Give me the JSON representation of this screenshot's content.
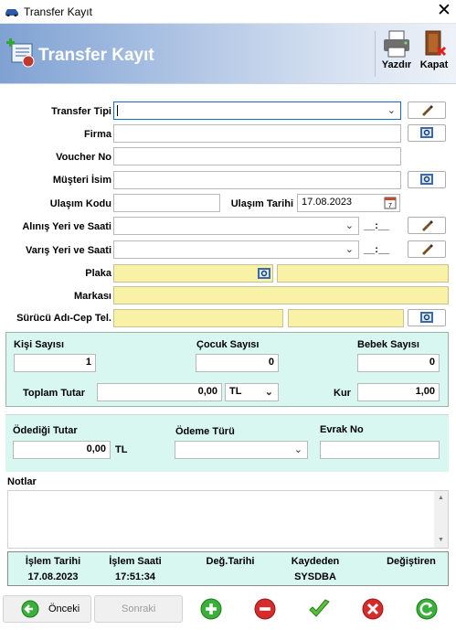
{
  "window": {
    "title": "Transfer Kayıt",
    "close_glyph": "✕"
  },
  "header": {
    "title": "Transfer Kayıt",
    "print_label": "Yazdır",
    "close_label": "Kapat"
  },
  "form": {
    "transfer_tipi_label": "Transfer Tipi",
    "firma_label": "Firma",
    "voucher_label": "Voucher No",
    "musteri_label": "Müşteri İsim",
    "ulasim_kodu_label": "Ulaşım Kodu",
    "ulasim_tarihi_label": "Ulaşım Tarihi",
    "ulasim_tarihi_value": "17.08.2023",
    "alinis_label": "Alınış Yeri ve Saati",
    "alinis_time": "__:__",
    "varis_label": "Varış Yeri ve Saati",
    "varis_time": "__:__",
    "plaka_label": "Plaka",
    "markasi_label": "Markası",
    "surucu_label": "Sürücü Adı-Cep Tel."
  },
  "counts": {
    "kisi_label": "Kişi Sayısı",
    "kisi_value": "1",
    "cocuk_label": "Çocuk Sayısı",
    "cocuk_value": "0",
    "bebek_label": "Bebek Sayısı",
    "bebek_value": "0",
    "toplam_label": "Toplam Tutar",
    "toplam_value": "0,00",
    "currency_value": "TL",
    "kur_label": "Kur",
    "kur_value": "1,00"
  },
  "payment": {
    "odedigi_label": "Ödediği Tutar",
    "odedigi_value": "0,00",
    "currency_text": "TL",
    "odeme_turu_label": "Ödeme Türü",
    "evrak_label": "Evrak No"
  },
  "notes": {
    "label": "Notlar"
  },
  "footer": {
    "islem_tarihi_label": "İşlem Tarihi",
    "islem_tarihi_value": "17.08.2023",
    "islem_saati_label": "İşlem Saati",
    "islem_saati_value": "17:51:34",
    "deg_tarihi_label": "Değ.Tarihi",
    "deg_tarihi_value": "",
    "kaydeden_label": "Kaydeden",
    "kaydeden_value": "SYSDBA",
    "degistiren_label": "Değiştiren",
    "degistiren_value": ""
  },
  "nav": {
    "prev_label": "Önceki",
    "next_label": "Sonraki"
  },
  "colors": {
    "banner_start": "#7fa2d3",
    "highlight_yellow": "#f9f1a6",
    "panel_cyan": "#d8f7f1",
    "add_green": "#3ab03a",
    "delete_red": "#d62b2b"
  }
}
